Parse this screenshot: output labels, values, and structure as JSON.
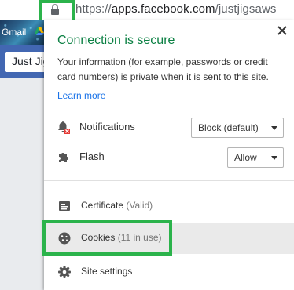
{
  "browser": {
    "url_scheme": "https://",
    "url_host": "apps.facebook.com",
    "url_path": "/justjigsaws",
    "bookmarks": [
      {
        "label": "Gmail",
        "icon": "gmail"
      },
      {
        "label": "",
        "icon": "google-drive-icon"
      }
    ],
    "page_search_text": "Just Jig"
  },
  "popup": {
    "title": "Connection is secure",
    "description": "Your information (for example, passwords or credit card numbers) is private when it is sent to this site.",
    "learn_more": "Learn more",
    "permissions": [
      {
        "label": "Notifications",
        "value": "Block (default)",
        "icon": "notification-blocked-icon"
      },
      {
        "label": "Flash",
        "value": "Allow",
        "icon": "puzzle-piece-icon"
      }
    ],
    "menu": [
      {
        "label": "Certificate",
        "sub": "(Valid)",
        "icon": "certificate-icon"
      },
      {
        "label": "Cookies",
        "sub": "(11 in use)",
        "icon": "cookie-icon",
        "hovered": true
      },
      {
        "label": "Site settings",
        "sub": "",
        "icon": "gear-icon"
      }
    ]
  },
  "colors": {
    "secure_green": "#0b8043",
    "link_blue": "#1a73e8",
    "highlight_green": "#2bb34b",
    "facebook_blue": "#4267b2"
  }
}
